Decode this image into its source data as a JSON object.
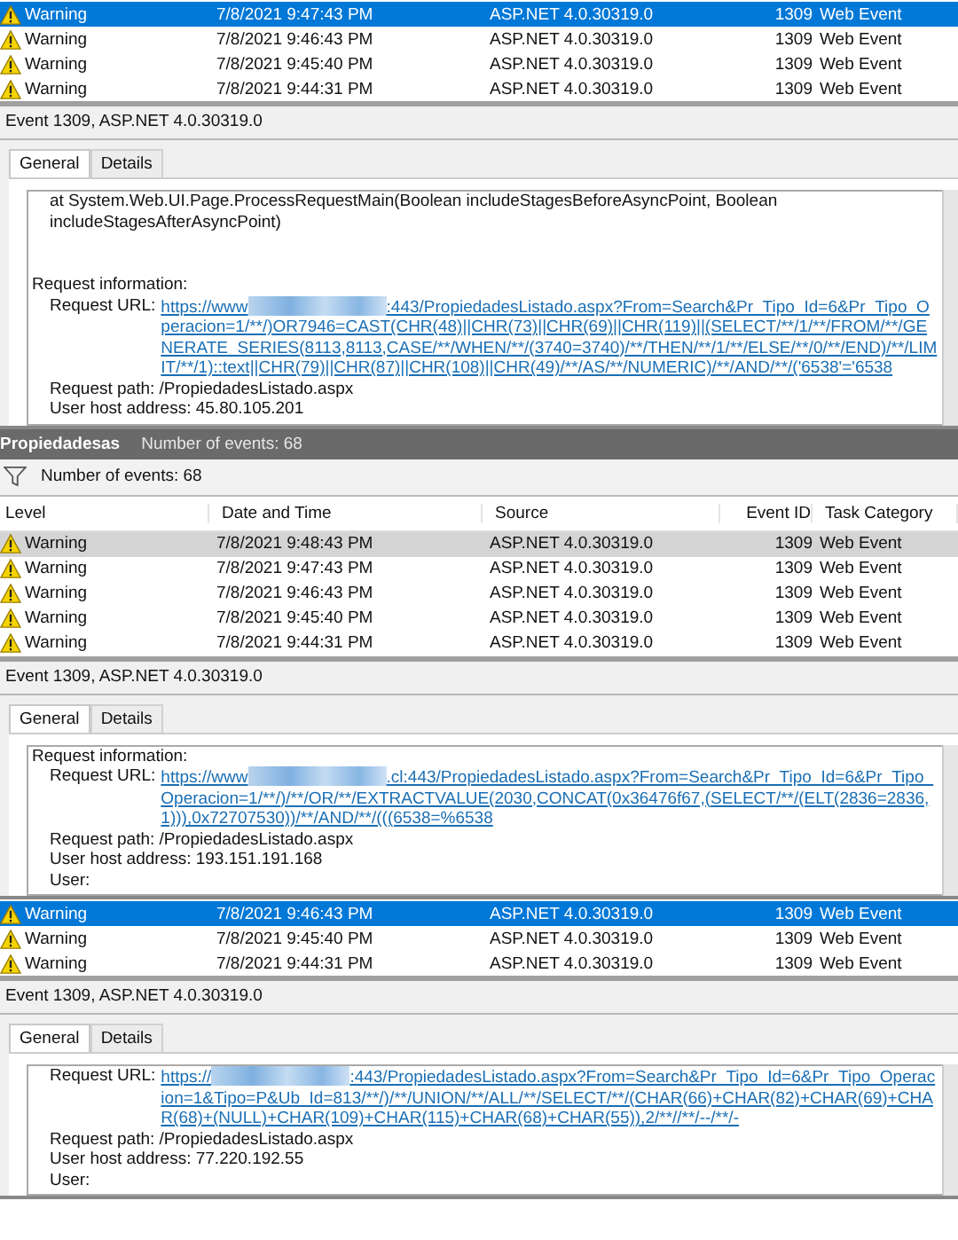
{
  "panels": [
    {
      "kind": "event_list",
      "focused": true,
      "rows": [
        {
          "level": "Warning",
          "date": "7/8/2021 9:47:43 PM",
          "source": "ASP.NET 4.0.30319.0",
          "event_id": "1309",
          "category": "Web Event",
          "selected": true
        },
        {
          "level": "Warning",
          "date": "7/8/2021 9:46:43 PM",
          "source": "ASP.NET 4.0.30319.0",
          "event_id": "1309",
          "category": "Web Event",
          "selected": false
        },
        {
          "level": "Warning",
          "date": "7/8/2021 9:45:40 PM",
          "source": "ASP.NET 4.0.30319.0",
          "event_id": "1309",
          "category": "Web Event",
          "selected": false
        },
        {
          "level": "Warning",
          "date": "7/8/2021 9:44:31 PM",
          "source": "ASP.NET 4.0.30319.0",
          "event_id": "1309",
          "category": "Web Event",
          "selected": false
        }
      ]
    },
    {
      "kind": "event_detail",
      "title": "Event 1309, ASP.NET 4.0.30319.0",
      "tabs": [
        {
          "label": "General",
          "selected": true
        },
        {
          "label": "Details",
          "selected": false
        }
      ],
      "lines": [
        {
          "kind": "trace",
          "text": "at System.Web.UI.Page.ProcessRequestMain(Boolean includeStagesBeforeAsyncPoint, Boolean includeStagesAfterAsyncPoint)"
        },
        {
          "kind": "heading",
          "text": "Request information:"
        },
        {
          "kind": "url",
          "label": "Request URL:",
          "url_start": "https://www",
          "url_end": ":443/PropiedadesListado.aspx?From=Search&Pr_Tipo_Id=6&Pr_Tipo_Operacion=1/**/)OR7946=CAST(CHR(48)||CHR(73)||CHR(69)||CHR(119)||(SELECT/**/1/**/FROM/**/GENERATE_SERIES(8113,8113,CASE/**/WHEN/**/(3740=3740)/**/THEN/**/1/**/ELSE/**/0/**/END)/**/LIMIT/**/1)::text||CHR(79)||CHR(87)||CHR(108)||CHR(49)/**/AS/**/NUMERIC)/**/AND/**/('6538'='6538"
        },
        {
          "kind": "field",
          "text": "Request path: /PropiedadesListado.aspx"
        },
        {
          "kind": "field",
          "text": "User host address: 45.80.105.201"
        }
      ]
    },
    {
      "kind": "log_header",
      "name": "Propiedadesas",
      "count": "Number of events: 68"
    },
    {
      "kind": "filter_bar",
      "text": "Number of events: 68"
    },
    {
      "kind": "event_list",
      "focused": false,
      "columns": [
        "Level",
        "Date and Time",
        "Source",
        "Event ID",
        "Task Category"
      ],
      "rows": [
        {
          "level": "Warning",
          "date": "7/8/2021 9:48:43 PM",
          "source": "ASP.NET 4.0.30319.0",
          "event_id": "1309",
          "category": "Web Event",
          "selected": true
        },
        {
          "level": "Warning",
          "date": "7/8/2021 9:47:43 PM",
          "source": "ASP.NET 4.0.30319.0",
          "event_id": "1309",
          "category": "Web Event",
          "selected": false
        },
        {
          "level": "Warning",
          "date": "7/8/2021 9:46:43 PM",
          "source": "ASP.NET 4.0.30319.0",
          "event_id": "1309",
          "category": "Web Event",
          "selected": false
        },
        {
          "level": "Warning",
          "date": "7/8/2021 9:45:40 PM",
          "source": "ASP.NET 4.0.30319.0",
          "event_id": "1309",
          "category": "Web Event",
          "selected": false
        },
        {
          "level": "Warning",
          "date": "7/8/2021 9:44:31 PM",
          "source": "ASP.NET 4.0.30319.0",
          "event_id": "1309",
          "category": "Web Event",
          "selected": false
        }
      ]
    },
    {
      "kind": "event_detail",
      "title": "Event 1309, ASP.NET 4.0.30319.0",
      "tabs": [
        {
          "label": "General",
          "selected": true
        },
        {
          "label": "Details",
          "selected": false
        }
      ],
      "lines": [
        {
          "kind": "heading",
          "text": "Request information:"
        },
        {
          "kind": "url",
          "label": "Request URL:",
          "url_start": "https://www",
          "url_end": ".cl:443/PropiedadesListado.aspx?From=Search&Pr_Tipo_Id=6&Pr_Tipo_Operacion=1/**/)/**/OR/**/EXTRACTVALUE(2030,CONCAT(0x36476f67,(SELECT/**/(ELT(2836=2836,1))),0x72707530))/**/AND/**/(((6538=%6538"
        },
        {
          "kind": "field",
          "text": "Request path: /PropiedadesListado.aspx"
        },
        {
          "kind": "field",
          "text": "User host address: 193.151.191.168"
        },
        {
          "kind": "field",
          "text": "User:"
        }
      ]
    },
    {
      "kind": "event_list",
      "focused": true,
      "rows": [
        {
          "level": "Warning",
          "date": "7/8/2021 9:46:43 PM",
          "source": "ASP.NET 4.0.30319.0",
          "event_id": "1309",
          "category": "Web Event",
          "selected": true
        },
        {
          "level": "Warning",
          "date": "7/8/2021 9:45:40 PM",
          "source": "ASP.NET 4.0.30319.0",
          "event_id": "1309",
          "category": "Web Event",
          "selected": false
        },
        {
          "level": "Warning",
          "date": "7/8/2021 9:44:31 PM",
          "source": "ASP.NET 4.0.30319.0",
          "event_id": "1309",
          "category": "Web Event",
          "selected": false
        }
      ]
    },
    {
      "kind": "event_detail",
      "title": "Event 1309, ASP.NET 4.0.30319.0",
      "tabs": [
        {
          "label": "General",
          "selected": true
        },
        {
          "label": "Details",
          "selected": false
        }
      ],
      "lines": [
        {
          "kind": "url",
          "label": "Request URL:",
          "url_start": "https://",
          "url_end": ":443/PropiedadesListado.aspx?From=Search&Pr_Tipo_Id=6&Pr_Tipo_Operacion=1&Tipo=P&Ub_Id=813/**/)/**/UNION/**/ALL/**/SELECT/**/(CHAR(66)+CHAR(82)+CHAR(69)+CHAR(68)+(NULL)+CHAR(109)+CHAR(115)+CHAR(68)+CHAR(55)),2/**//**/--/**/-"
        },
        {
          "kind": "field",
          "text": "Request path: /PropiedadesListado.aspx"
        },
        {
          "kind": "field",
          "text": "User host address: 77.220.192.55"
        },
        {
          "kind": "field",
          "text": "User:"
        }
      ]
    }
  ]
}
